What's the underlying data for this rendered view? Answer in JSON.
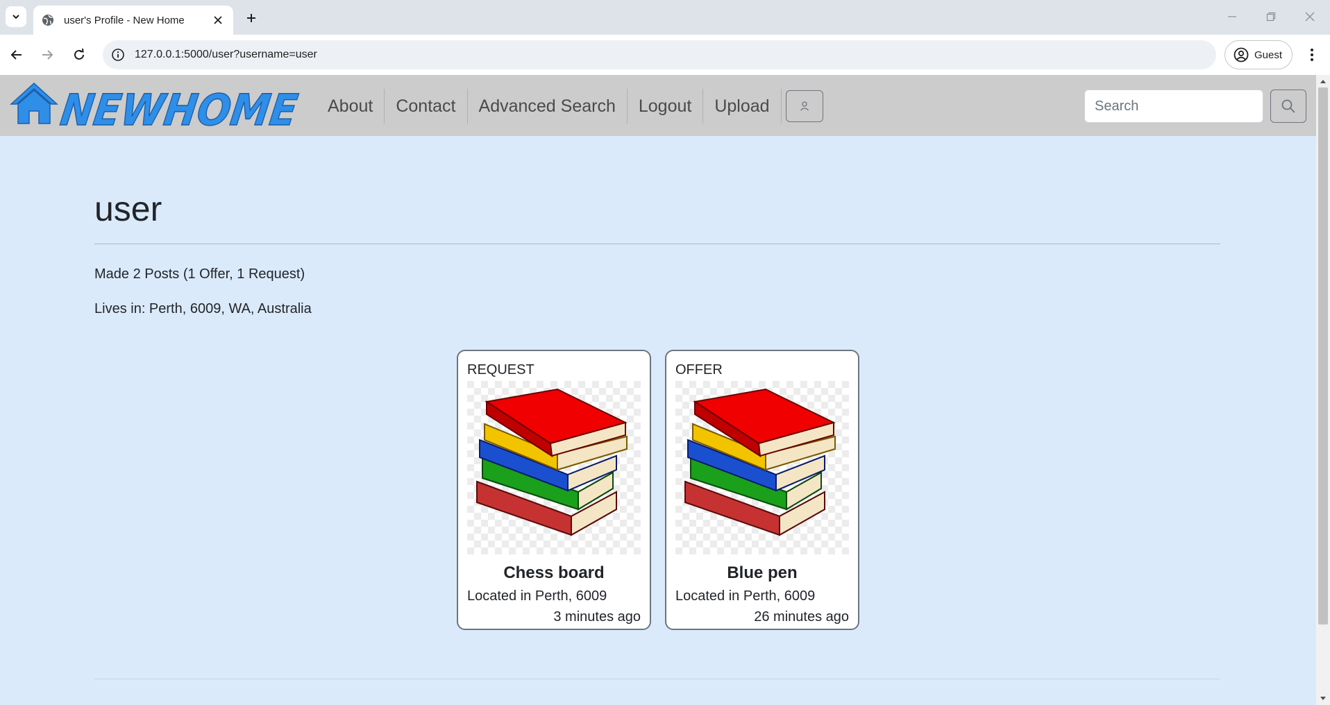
{
  "browser": {
    "tab_title": "user's Profile - New Home",
    "url": "127.0.0.1:5000/user?username=user",
    "profile_label": "Guest"
  },
  "site": {
    "logo_text": "NEWHOME",
    "nav": [
      {
        "label": "About"
      },
      {
        "label": "Contact"
      },
      {
        "label": "Advanced Search"
      },
      {
        "label": "Logout"
      },
      {
        "label": "Upload"
      }
    ],
    "search_placeholder": "Search"
  },
  "profile": {
    "username": "user",
    "posts_summary": "Made 2 Posts (1 Offer, 1 Request)",
    "location": "Lives in: Perth, 6009, WA, Australia"
  },
  "posts": [
    {
      "type": "REQUEST",
      "title": "Chess board",
      "location": "Located in Perth, 6009",
      "time": "3 minutes ago"
    },
    {
      "type": "OFFER",
      "title": "Blue pen",
      "location": "Located in Perth, 6009",
      "time": "26 minutes ago"
    }
  ],
  "colors": {
    "logo_blue": "#2f8ee8",
    "nav_bg": "#cccccc",
    "page_bg": "#dbeafb"
  }
}
